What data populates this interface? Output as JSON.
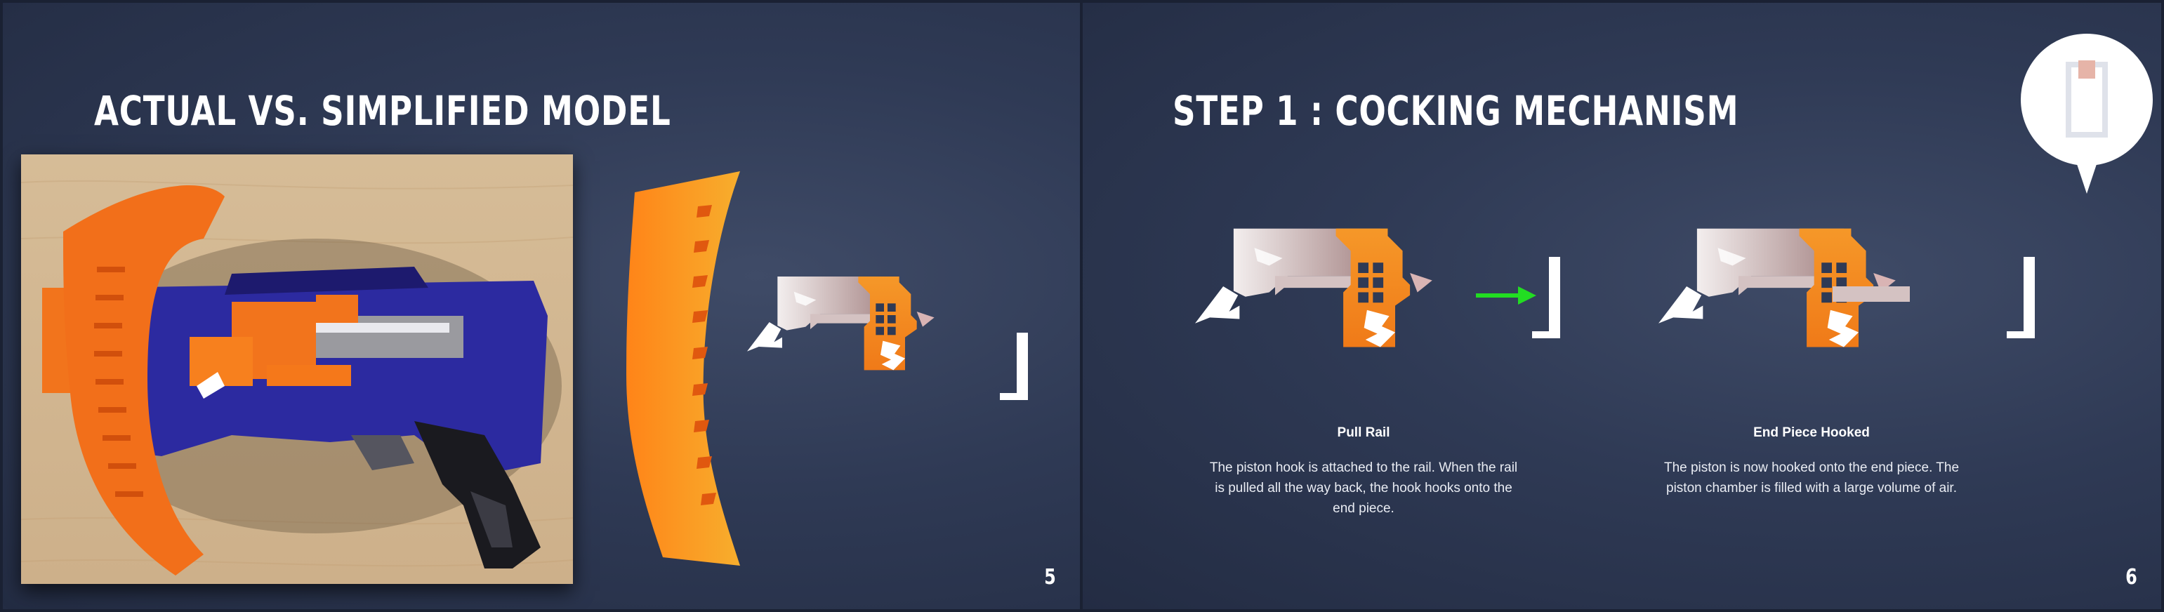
{
  "slide5": {
    "title": "ACTUAL VS. SIMPLIFIED MODEL",
    "page_number": "5"
  },
  "slide6": {
    "title": "STEP 1 : COCKING MECHANISM",
    "page_number": "6",
    "left_caption": {
      "title": "Pull Rail",
      "body": "The piston hook is attached to the rail. When the rail is pulled all the way back, the hook hooks onto the end piece."
    },
    "right_caption": {
      "title": "End Piece Hooked",
      "body": "The piston is now hooked onto the end piece. The piston chamber is filled with a large volume of air."
    }
  },
  "colors": {
    "background": "#2f3a55",
    "accent_orange": "#f28a1c",
    "arrow_green": "#22dd22",
    "rail_pink": "#d8c4c4",
    "text": "#ffffff"
  },
  "icons": {
    "callout": "zoom-callout-icon",
    "arrow": "arrow-right-icon"
  }
}
